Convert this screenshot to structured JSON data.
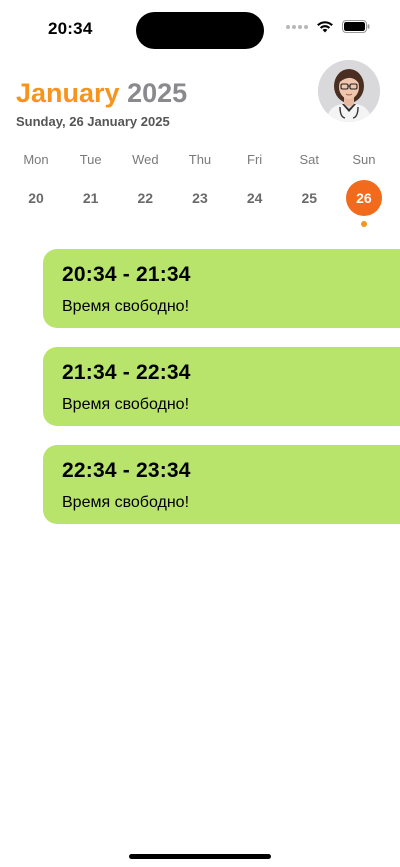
{
  "status_bar": {
    "time": "20:34"
  },
  "header": {
    "month": "January",
    "year": "2025",
    "date_line": "Sunday, 26 January 2025"
  },
  "colors": {
    "accent_orange": "#f7941d",
    "selected_day": "#f26a1b",
    "slot_green": "#b8e46c"
  },
  "week": [
    {
      "name": "Mon",
      "num": "20"
    },
    {
      "name": "Tue",
      "num": "21"
    },
    {
      "name": "Wed",
      "num": "22"
    },
    {
      "name": "Thu",
      "num": "23"
    },
    {
      "name": "Fri",
      "num": "24"
    },
    {
      "name": "Sat",
      "num": "25"
    },
    {
      "name": "Sun",
      "num": "26"
    }
  ],
  "selected_day": "26",
  "slots": [
    {
      "time": "20:34 - 21:34",
      "status": "Время свободно!"
    },
    {
      "time": "21:34 - 22:34",
      "status": "Время свободно!"
    },
    {
      "time": "22:34 - 23:34",
      "status": "Время свободно!"
    }
  ]
}
